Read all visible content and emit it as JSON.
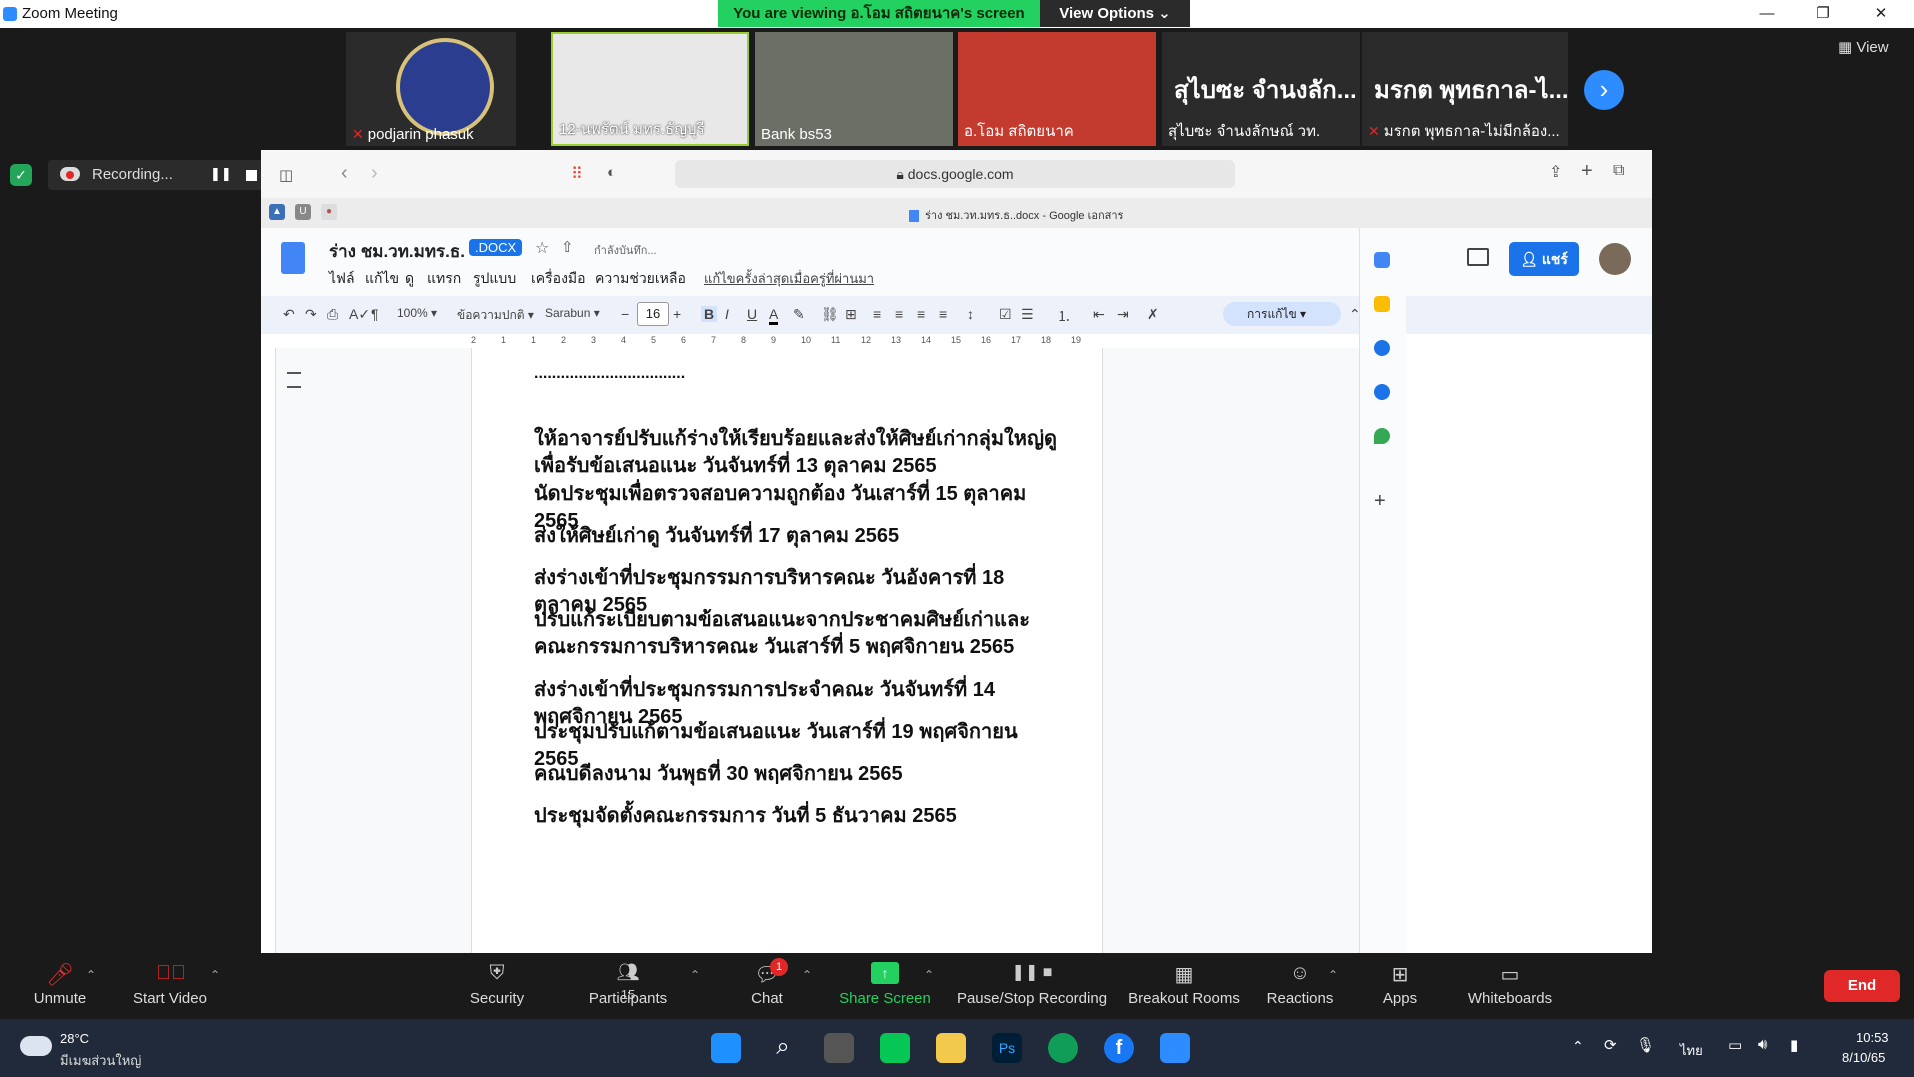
{
  "window": {
    "title": "Zoom Meeting",
    "viewing_banner": "You are viewing อ.โอม สถิตยนาค's screen",
    "view_options": "View Options ⌄"
  },
  "thumbnails": [
    {
      "name": "podjarin phasuk",
      "muted": true
    },
    {
      "name": "12-นพรัตน์ มทร.ธัญบุรี",
      "muted": false
    },
    {
      "name": "Bank bs53",
      "muted": false
    },
    {
      "name": "อ.โอม สถิตยนาค",
      "muted": false
    },
    {
      "name": "สุไบซะ จำนงลักษณ์ วท.",
      "bigname": "สุไบซะ จำนงลัก...",
      "muted": false
    },
    {
      "name": "มรกต พุทธกาล-ไม่มีกล้อง...",
      "bigname": "มรกต พุทธกาล-ไ...",
      "muted": true
    }
  ],
  "view_button": "View",
  "recording": {
    "label": "Recording..."
  },
  "browser": {
    "address": "docs.google.com",
    "tab_title": "ร่าง ชม.วท.มทร.ธ..docx - Google เอกสาร"
  },
  "docs": {
    "title": "ร่าง ชม.วท.มทร.ธ.",
    "badge": ".DOCX",
    "saving": "กำลังบันทึก...",
    "menu": [
      "ไฟล์",
      "แก้ไข",
      "ดู",
      "แทรก",
      "รูปแบบ",
      "เครื่องมือ",
      "ความช่วยเหลือ"
    ],
    "last_edit": "แก้ไขครั้งล่าสุดเมื่อครู่ที่ผ่านมา",
    "share": "แชร์",
    "toolbar": {
      "zoom": "100%",
      "style": "ข้อความปกติ",
      "font": "Sarabun",
      "font_size": "16",
      "edit_mode": "การแก้ไข"
    },
    "ruler": [
      "2",
      "1",
      "1",
      "2",
      "3",
      "4",
      "5",
      "6",
      "7",
      "8",
      "9",
      "10",
      "11",
      "12",
      "13",
      "14",
      "15",
      "16",
      "17",
      "18",
      "19"
    ],
    "lines": [
      "..................................",
      "ให้อาจารย์ปรับแก้ร่างให้เรียบร้อยและส่งให้ศิษย์เก่ากลุ่มใหญ่ดูเพื่อรับข้อเสนอแนะ วันจันทร์ที่ 13 ตุลาคม 2565",
      "นัดประชุมเพื่อตรวจสอบความถูกต้อง วันเสาร์ที่ 15 ตุลาคม 2565",
      "ส่งให้ศิษย์เก่าดู วันจันทร์ที่ 17 ตุลาคม 2565",
      "ส่งร่างเข้าที่ประชุมกรรมการบริหารคณะ วันอังคารที่ 18 ตุลาคม 2565",
      "ปรับแก้ระเบียบตามข้อเสนอแนะจากประชาคมศิษย์เก่าและคณะกรรมการบริหารคณะ วันเสาร์ที่ 5 พฤศจิกายน 2565",
      "ส่งร่างเข้าที่ประชุมกรรมการประจำคณะ วันจันทร์ที่ 14 พฤศจิกายน 2565",
      "ประชุมปรับแก้ตามข้อเสนอแนะ วันเสาร์ที่ 19 พฤศจิกายน 2565",
      "คณบดีลงนาม วันพุธที่ 30 พฤศจิกายน 2565",
      "ประชุมจัดตั้งคณะกรรมการ วันที่ 5 ธันวาคม 2565"
    ]
  },
  "zoom_controls": {
    "unmute": "Unmute",
    "start_video": "Start Video",
    "security": "Security",
    "participants": "Participants",
    "participants_count": "15",
    "chat": "Chat",
    "chat_badge": "1",
    "share_screen": "Share Screen",
    "pause_stop": "Pause/Stop Recording",
    "breakout": "Breakout Rooms",
    "reactions": "Reactions",
    "apps": "Apps",
    "whiteboards": "Whiteboards",
    "end": "End"
  },
  "taskbar": {
    "temperature": "28°C",
    "weather": "มีเมฆส่วนใหญ่",
    "language": "ไทย",
    "time": "10:53",
    "date": "8/10/65"
  },
  "colors": {
    "share_green": "#23d160",
    "zoom_blue": "#2d8cff",
    "end_red": "#e02828",
    "docs_blue": "#1a73e8"
  }
}
